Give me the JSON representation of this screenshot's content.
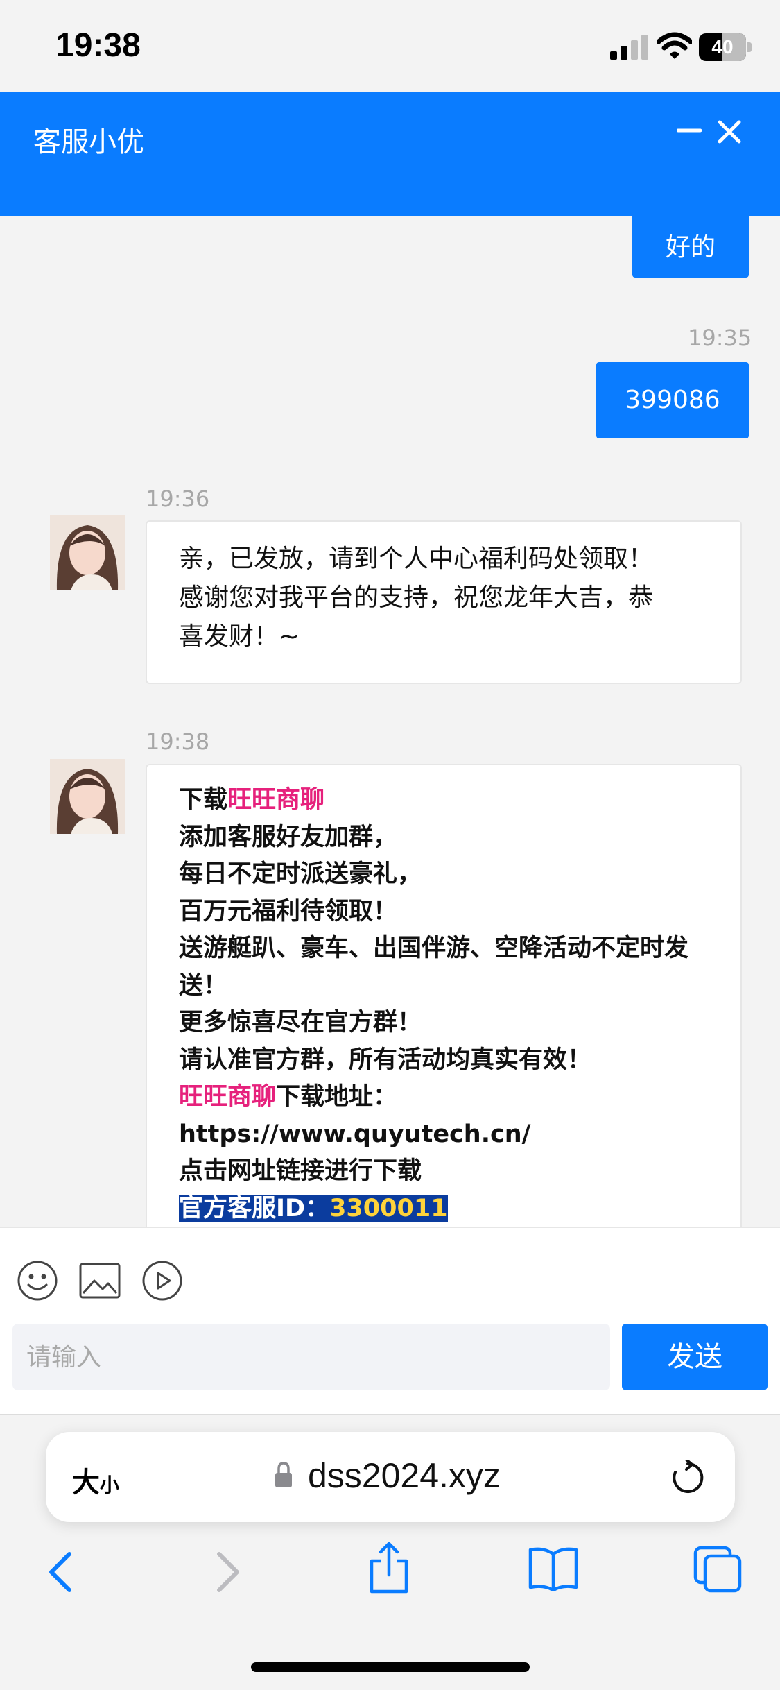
{
  "status_bar": {
    "time": "19:38",
    "battery_level": "40",
    "icons": [
      "cellular-signal-icon",
      "wifi-icon",
      "battery-icon"
    ]
  },
  "header": {
    "title": "客服小优",
    "minimize_icon": "minimize-icon",
    "close_icon": "close-icon",
    "accent_color": "#0a7cff"
  },
  "messages": [
    {
      "direction": "outgoing",
      "text": "好的"
    },
    {
      "direction": "outgoing",
      "time": "19:35",
      "text": "399086"
    },
    {
      "direction": "incoming",
      "time": "19:36",
      "lines": [
        "亲，已发放，请到个人中心福利码处领取！",
        "感谢您对我平台的支持，祝您龙年大吉，恭",
        "喜发财！~"
      ]
    },
    {
      "direction": "incoming",
      "time": "19:38",
      "download_prefix": "下载",
      "app_name": "旺旺商聊",
      "lines": [
        "添加客服好友加群，",
        "每日不定时派送豪礼，",
        "百万元福利待领取！",
        "送游艇趴、豪车、出国伴游、空降活动不定时发",
        "送！",
        "更多惊喜尽在官方群！",
        "请认准官方群，所有活动均真实有效！"
      ],
      "download_suffix": "下载地址：",
      "url": "https://www.quyutech.cn/",
      "click_text": "点击网址链接进行下载",
      "id_label": "官方客服ID：",
      "id_value": "3300011",
      "highlight_colors": {
        "app_name": "#e6217c",
        "selection_bg": "#0b3c9e",
        "id_value": "#ffd33a"
      }
    }
  ],
  "input_bar": {
    "tools": [
      "emoji-icon",
      "image-icon",
      "video-icon"
    ],
    "placeholder": "请输入",
    "value": "",
    "send_label": "发送"
  },
  "browser": {
    "text_size_big": "大",
    "text_size_small": "小",
    "url": "dss2024.xyz",
    "icons": [
      "lock-icon",
      "reload-icon",
      "back-icon",
      "forward-icon",
      "share-icon",
      "bookmarks-icon",
      "tabs-icon"
    ]
  }
}
